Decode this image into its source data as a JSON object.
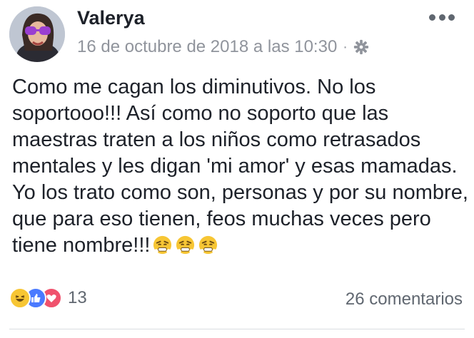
{
  "post": {
    "author": "Valerya",
    "timestamp": "16 de octubre de 2018 a las 10:30",
    "separator": "·",
    "privacy_icon": "gear-icon",
    "menu_icon": "more-options-icon",
    "text": "Como me cagan los diminutivos. No los soportooo!!! Así como no soporto que las maestras traten a los niños como retrasados mentales y les digan 'mi amor' y esas mamadas. Yo los trato como son, personas y por su nombre, que para eso tienen, feos muchas veces pero tiene nombre!!!",
    "trailing_emojis": [
      "steam-face-emoji",
      "steam-face-emoji",
      "steam-face-emoji"
    ]
  },
  "footer": {
    "reactions": [
      "haha-reaction-icon",
      "like-reaction-icon",
      "love-reaction-icon"
    ],
    "reaction_count": "13",
    "comments": "26 comentarios"
  },
  "colors": {
    "text": "#1d2129",
    "meta": "#90949c",
    "like": "#4a7aff",
    "love": "#f0526d",
    "haha": "#f7c634"
  }
}
